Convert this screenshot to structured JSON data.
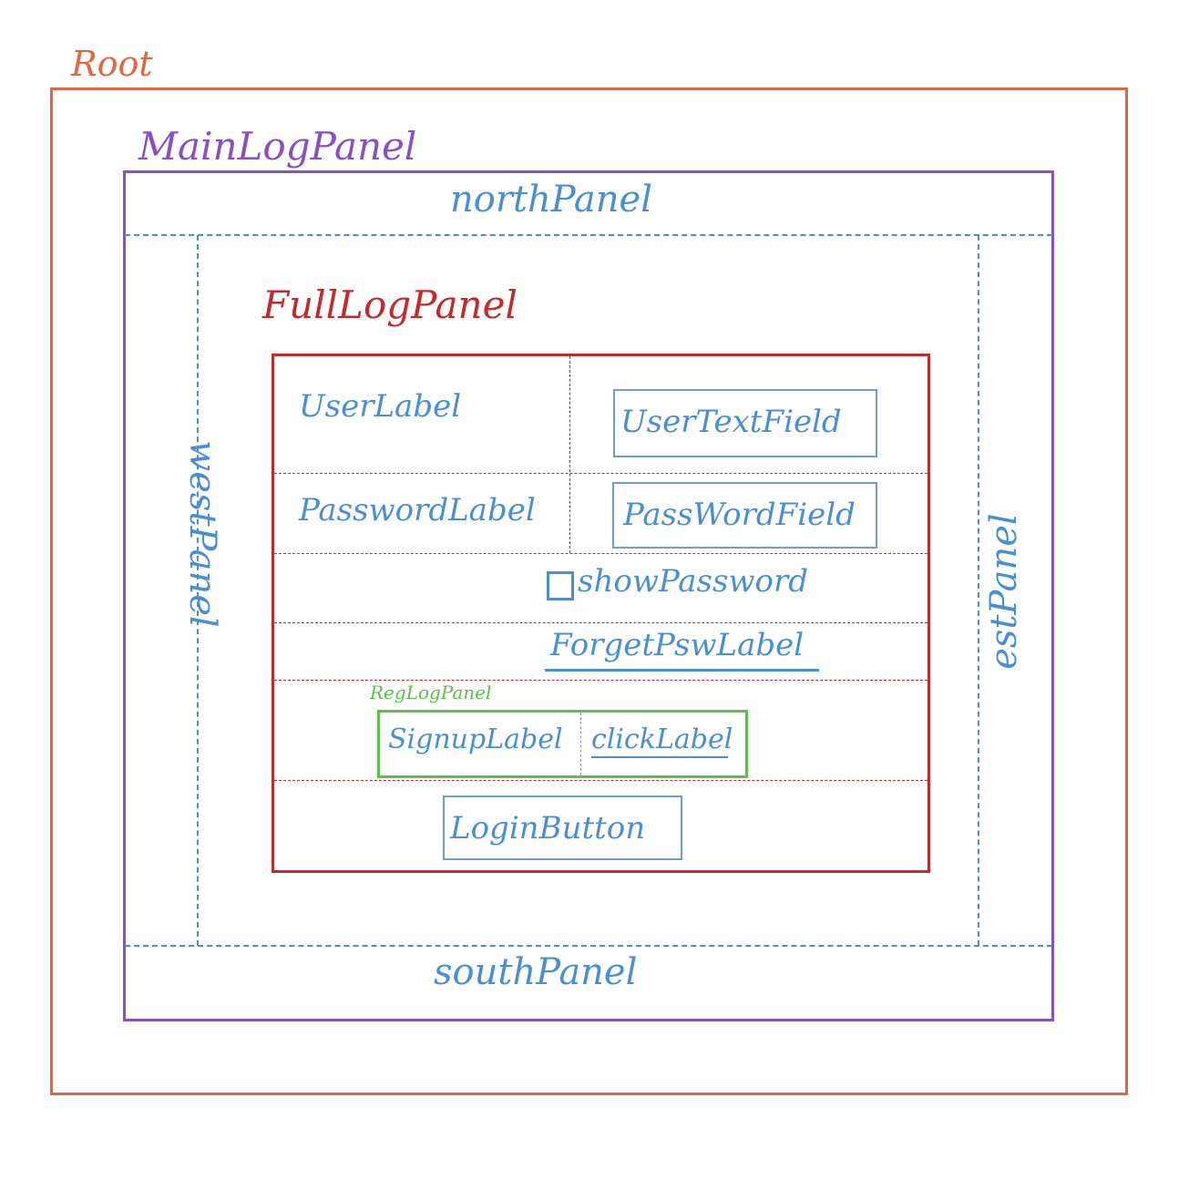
{
  "root": {
    "label": "Root"
  },
  "main_panel": {
    "label": "MainLogPanel"
  },
  "regions": {
    "north": "northPanel",
    "south": "southPanel",
    "west": "westPanel",
    "east": "estPanel"
  },
  "full_panel": {
    "label": "FullLogPanel",
    "user_label": "UserLabel",
    "user_field": "UserTextField",
    "password_label": "PasswordLabel",
    "password_field": "PassWordField",
    "show_password": "showPassword",
    "forget_label": "ForgetPswLabel",
    "login_button": "LoginButton"
  },
  "reg_panel": {
    "label": "RegLogPanel",
    "signup_label": "SignupLabel",
    "click_label": "clickLabel"
  },
  "colors": {
    "root": "#e2673f",
    "main": "#8a4fc4",
    "regions": "#4a8fd6",
    "full": "#c8282a",
    "reg": "#5cc04a"
  }
}
